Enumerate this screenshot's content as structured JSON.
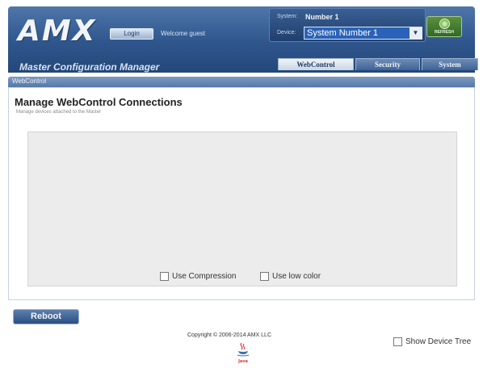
{
  "header": {
    "logo": "AMX",
    "login_button": "Login",
    "welcome": "Welcome guest",
    "system_label": "System:",
    "system_value": "Number 1",
    "device_label": "Device:",
    "device_value": "System Number 1",
    "refresh_label": "REFRESH",
    "app_title": "Master Configuration Manager",
    "tabs": [
      {
        "label": "WebControl",
        "active": true
      },
      {
        "label": "Security",
        "active": false
      },
      {
        "label": "System",
        "active": false
      }
    ]
  },
  "section": {
    "label": "WebControl",
    "heading": "Manage WebControl Connections",
    "subheading": "Manage devices attached to the Master"
  },
  "options": {
    "use_compression": "Use Compression",
    "use_low_color": "Use low color"
  },
  "footer": {
    "reboot_button": "Reboot",
    "copyright": "Copyright © 2006-2014 AMX LLC",
    "show_device_tree": "Show Device Tree",
    "java_label": "Java"
  },
  "colors": {
    "header_blue": "#2f568c",
    "tab_active": "#f2f5f9",
    "device_select": "#2a62b7",
    "refresh_green": "#2f6a24"
  }
}
